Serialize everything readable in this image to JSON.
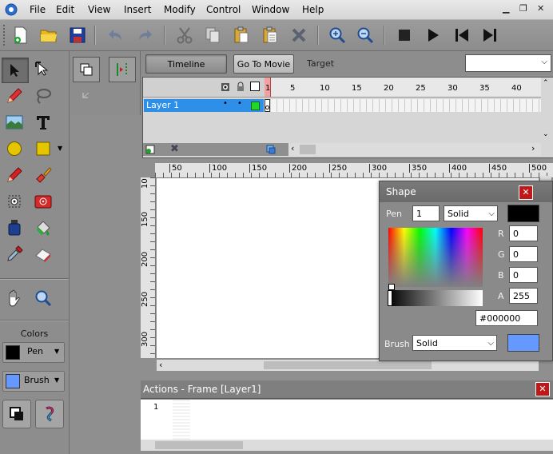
{
  "menu": {
    "items": [
      "File",
      "Edit",
      "View",
      "Insert",
      "Modify",
      "Control",
      "Window",
      "Help"
    ]
  },
  "timeline": {
    "tab_timeline": "Timeline",
    "tab_goto": "Go To Movie",
    "target_label": "Target",
    "target_value": "",
    "frame_numbers": [
      "1",
      "5",
      "10",
      "15",
      "20",
      "25",
      "30",
      "35",
      "40"
    ],
    "layer_name": "Layer 1"
  },
  "rulers": {
    "h_ticks": [
      "50",
      "100",
      "150",
      "200",
      "250",
      "300",
      "350",
      "400",
      "450",
      "500"
    ],
    "v_ticks": [
      "10",
      "150",
      "200",
      "250",
      "300"
    ]
  },
  "colors_panel": {
    "title": "Colors",
    "pen_label": "Pen",
    "brush_label": "Brush",
    "pen_color": "#000000",
    "brush_color": "#6699ff"
  },
  "shape_dialog": {
    "title": "Shape",
    "pen_label": "Pen",
    "pen_width": "1",
    "pen_style": "Solid",
    "r_label": "R",
    "r_value": "0",
    "g_label": "G",
    "g_value": "0",
    "b_label": "B",
    "b_value": "0",
    "a_label": "A",
    "a_value": "255",
    "hex_value": "#000000",
    "brush_label": "Brush",
    "brush_style": "Solid",
    "pen_swatch": "#000000",
    "brush_swatch": "#6699ff"
  },
  "actions": {
    "title": "Actions - Frame [Layer1]",
    "line_number": "1"
  }
}
